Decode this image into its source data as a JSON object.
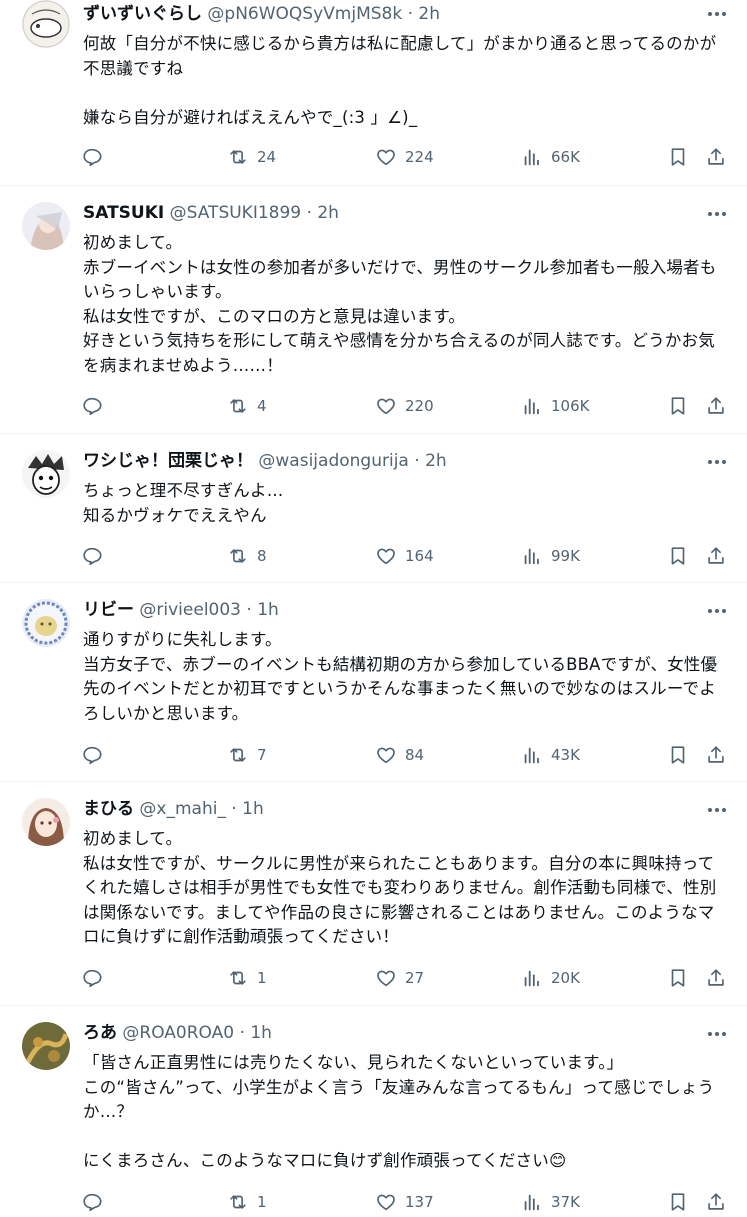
{
  "tweets": [
    {
      "name": "ずいずいぐらし",
      "handle": "@pN6WOQSyVmjMS8k",
      "time": "2h",
      "text": "何故「自分が不快に感じるから貴方は私に配慮して」がまかり通ると思ってるのかが不思議ですね\n\n嫌なら自分が避ければええんやで_(:3 」∠)_",
      "retweets": "24",
      "likes": "224",
      "views": "66K",
      "avatar": "cat-sketch-avatar"
    },
    {
      "name": "SATSUKI",
      "handle": "@SATSUKI1899",
      "time": "2h",
      "text": "初めまして。\n赤ブーイベントは女性の参加者が多いだけで、男性のサークル参加者も一般入場者もいらっしゃいます。\n私は女性ですが、このマロの方と意見は違います。\n好きという気持ちを形にして萌えや感情を分かち合えるのが同人誌です。どうかお気を病まれませぬよう……！",
      "retweets": "4",
      "likes": "220",
      "views": "106K",
      "avatar": "anime-girl-avatar"
    },
    {
      "name": "ワシじゃ！団栗じゃ！",
      "handle": "@wasijadongurija",
      "time": "2h",
      "text": "ちょっと理不尽すぎんよ…\n知るかヴォケでええやん",
      "retweets": "8",
      "likes": "164",
      "views": "99K",
      "avatar": "manga-face-avatar"
    },
    {
      "name": "リビー",
      "handle": "@rivieel003",
      "time": "1h",
      "text": "通りすがりに失礼します。\n当方女子で、赤ブーのイベントも結構初期の方から参加しているBBAですが、女性優先のイベントだとか初耳ですというかそんな事まったく無いので妙なのはスルーでよろしいかと思います。",
      "retweets": "7",
      "likes": "84",
      "views": "43K",
      "avatar": "plate-avatar"
    },
    {
      "name": "まひる",
      "handle": "@x_mahi_",
      "time": "1h",
      "text": "初めまして。\n私は女性ですが、サークルに男性が来られたこともあります。自分の本に興味持ってくれた嬉しさは相手が男性でも女性でも変わりありません。創作活動も同様で、性別は関係ないです。ましてや作品の良さに影響されることはありません。このようなマロに負けずに創作活動頑張ってください！",
      "retweets": "1",
      "likes": "27",
      "views": "20K",
      "avatar": "girl-portrait-avatar"
    },
    {
      "name": "ろあ",
      "handle": "@ROA0ROA0",
      "time": "1h",
      "text": "「皆さん正直男性には売りたくない、見られたくないといっています。」\nこの“皆さん”って、小学生がよく言う「友達みんな言ってるもん」って感じでしょうか…？\n\nにくまろさん、このようなマロに負けず創作頑張ってください😊",
      "retweets": "1",
      "likes": "137",
      "views": "37K",
      "avatar": "golden-art-avatar"
    }
  ],
  "separator": "·",
  "icons": {
    "more": "more-icon",
    "reply": "reply-icon",
    "retweet": "retweet-icon",
    "like": "heart-icon",
    "views": "views-icon",
    "bookmark": "bookmark-icon",
    "share": "share-icon"
  },
  "colors": {
    "text": "#0f1419",
    "secondary": "#536471",
    "divider": "#eff3f4"
  }
}
